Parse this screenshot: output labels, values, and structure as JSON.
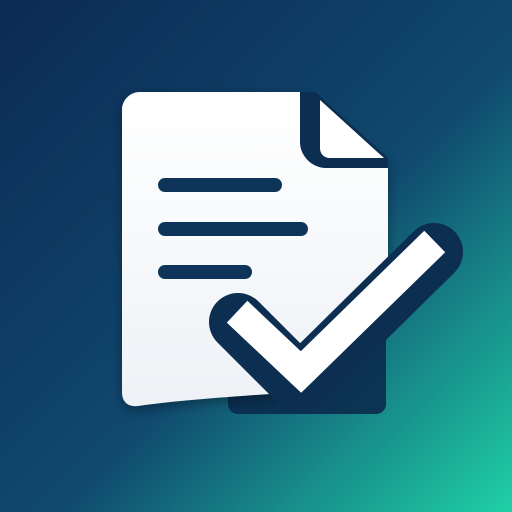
{
  "app_icon": {
    "name": "document-checklist",
    "icons": [
      "document-icon",
      "folded-corner-icon",
      "text-line-icon",
      "checkmark-icon"
    ],
    "colors": {
      "background_top_left": "#0B2A55",
      "background_mid": "#10486E",
      "background_bottom_right": "#1FD0A6",
      "document_fill": "#FFFFFF",
      "document_shadow": "#D8DEE6",
      "text_lines": "#0E3559",
      "check_outline": "#0C2E50",
      "check_fill": "#FFFFFF"
    }
  }
}
